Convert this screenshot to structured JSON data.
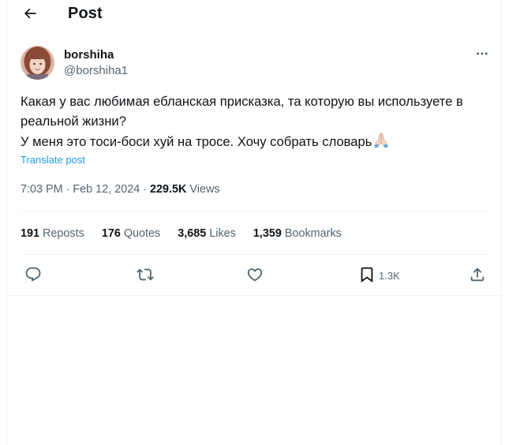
{
  "header": {
    "title": "Post",
    "back_icon": "arrow-left-icon"
  },
  "author": {
    "display_name": "borshiha",
    "handle": "@borshiha1",
    "avatar_bg": "#c98a7a"
  },
  "post": {
    "lines": [
      "Какая у вас любимая ебланская присказка, та которую вы используете в",
      "реальной жизни?",
      "У меня это тоси-боси хуй на тросе. Хочу собрать словарь"
    ],
    "emoji": "folded-hands-icon",
    "translate_label": "Translate post",
    "time": "7:03 PM",
    "separator": " · ",
    "date": "Feb 12, 2024",
    "views_count": "229.5K",
    "views_label": " Views"
  },
  "stats": [
    {
      "count": "191",
      "label": "Reposts"
    },
    {
      "count": "176",
      "label": "Quotes"
    },
    {
      "count": "3,685",
      "label": "Likes"
    },
    {
      "count": "1,359",
      "label": "Bookmarks"
    }
  ],
  "actions": {
    "reply_icon": "reply-icon",
    "repost_icon": "repost-icon",
    "like_icon": "heart-icon",
    "bookmark_icon": "bookmark-icon",
    "bookmark_count": "1.3K",
    "share_icon": "share-icon"
  },
  "colors": {
    "accent": "#1d9bf0",
    "text_primary": "#0f1419",
    "text_secondary": "#536471",
    "border": "#eff3f4"
  }
}
